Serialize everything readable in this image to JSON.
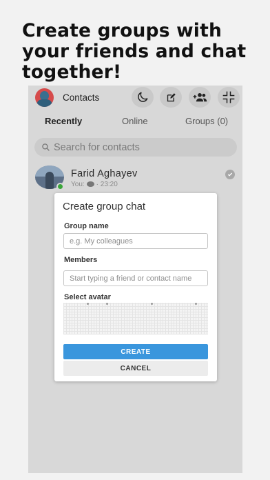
{
  "headline": "Create groups with your friends and chat together!",
  "header": {
    "title": "Contacts",
    "icons": [
      "moon-icon",
      "compose-icon",
      "add-group-icon",
      "collapse-icon"
    ]
  },
  "tabs": [
    {
      "label": "Recently",
      "active": true
    },
    {
      "label": "Online",
      "active": false
    },
    {
      "label": "Groups (0)",
      "active": false
    }
  ],
  "search": {
    "placeholder": "Search for contacts"
  },
  "contacts": [
    {
      "name": "Farid Aghayev",
      "preview_prefix": "You:",
      "time": "23:20",
      "online": true,
      "read": true
    }
  ],
  "modal": {
    "title": "Create group chat",
    "group_name_label": "Group name",
    "group_name_placeholder": "e.g. My colleagues",
    "members_label": "Members",
    "members_placeholder": "Start typing a friend or contact name",
    "avatar_label": "Select avatar",
    "create_label": "CREATE",
    "cancel_label": "CANCEL"
  },
  "colors": {
    "accent": "#3a96dd",
    "online": "#3aa53a",
    "panel_bg": "#d8d8d8",
    "page_bg": "#f2f2f2"
  }
}
